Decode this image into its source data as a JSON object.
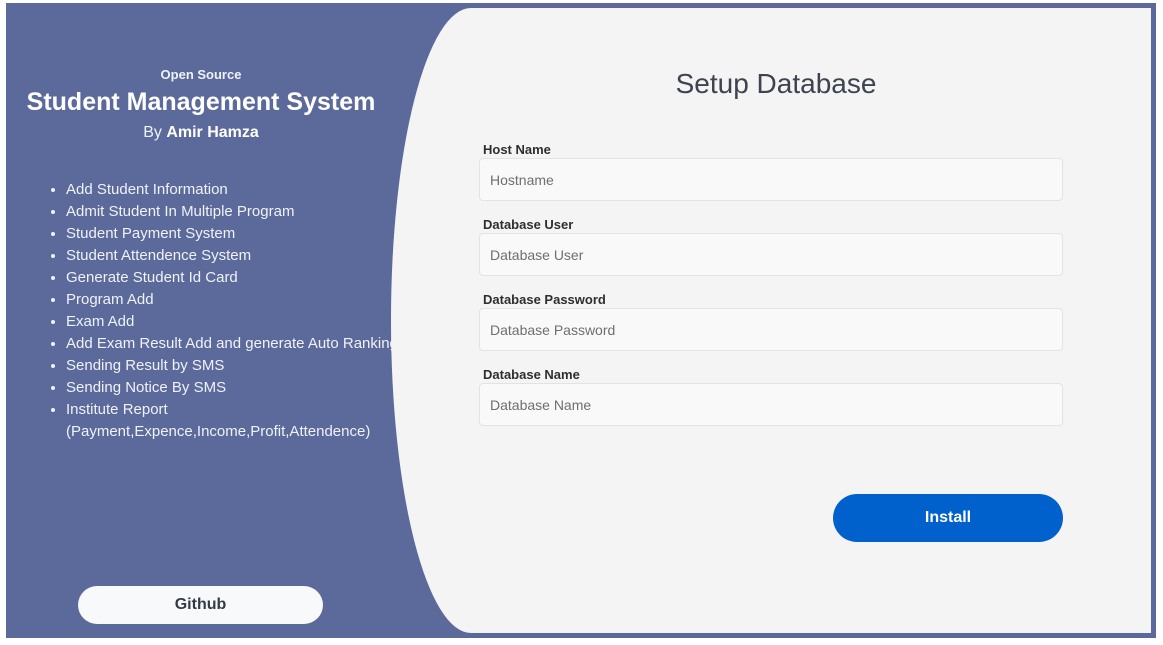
{
  "sidebar": {
    "subtitle": "Open Source",
    "title": "Student Management System",
    "by_prefix": "By ",
    "author": "Amir Hamza",
    "features": [
      "Add Student Information",
      "Admit Student In Multiple Program",
      "Student Payment System",
      "Student Attendence System",
      "Generate Student Id Card",
      "Program Add",
      "Exam Add",
      "Add Exam Result Add and generate Auto Ranking",
      "Sending Result by SMS",
      "Sending Notice By SMS",
      "Institute Report (Payment,Expence,Income,Profit,Attendence)"
    ],
    "github_label": "Github"
  },
  "form": {
    "title": "Setup Database",
    "fields": [
      {
        "label": "Host Name",
        "placeholder": "Hostname",
        "value": ""
      },
      {
        "label": "Database User",
        "placeholder": "Database User",
        "value": ""
      },
      {
        "label": "Database Password",
        "placeholder": "Database Password",
        "value": ""
      },
      {
        "label": "Database Name",
        "placeholder": "Database Name",
        "value": ""
      }
    ],
    "install_label": "Install"
  },
  "colors": {
    "frame": "#5b6a9a",
    "panel": "#f4f4f4",
    "primary_button": "#0060cc"
  }
}
